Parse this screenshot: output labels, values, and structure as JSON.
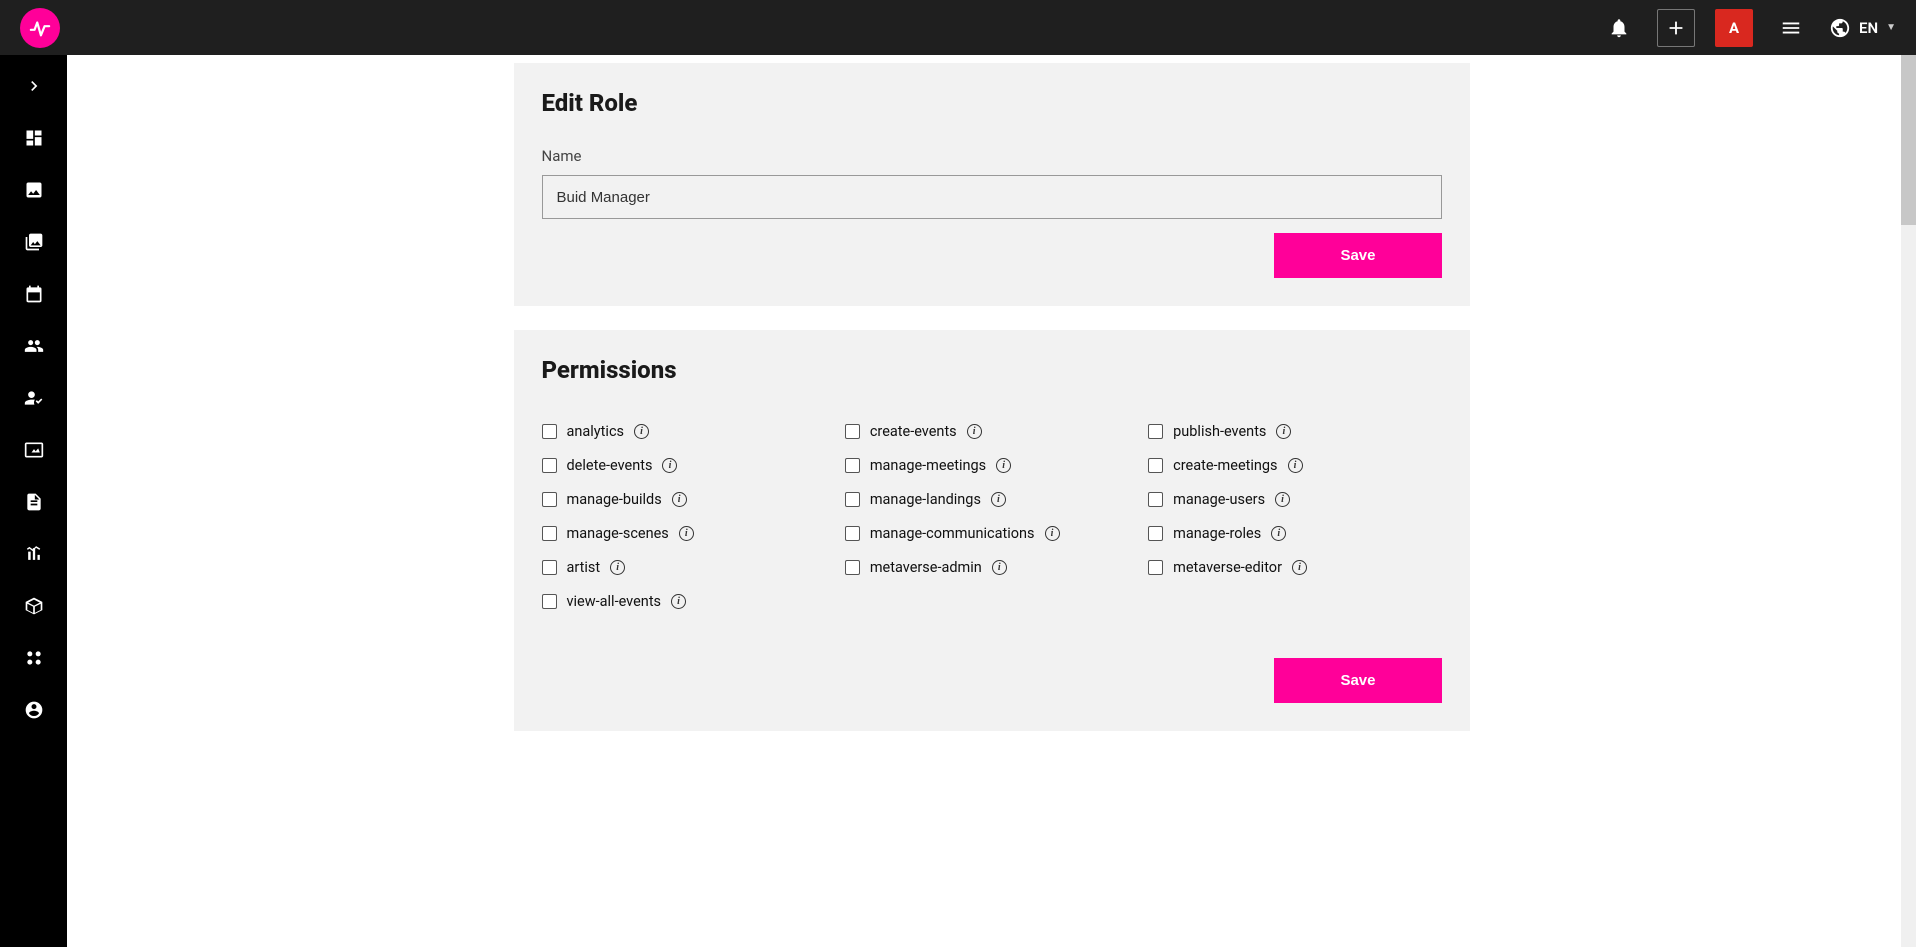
{
  "colors": {
    "accent": "#ff0099",
    "avatar_bg": "#d9281f",
    "topbar_bg": "#1f1f1f",
    "sidebar_bg": "#000000",
    "card_bg": "#f2f2f2"
  },
  "topbar": {
    "avatar_letter": "A",
    "language": "EN"
  },
  "edit_role": {
    "title": "Edit Role",
    "name_label": "Name",
    "name_value": "Buid Manager",
    "save_label": "Save"
  },
  "permissions": {
    "title": "Permissions",
    "save_label": "Save",
    "items": [
      {
        "label": "analytics",
        "checked": false
      },
      {
        "label": "create-events",
        "checked": false
      },
      {
        "label": "publish-events",
        "checked": false
      },
      {
        "label": "delete-events",
        "checked": false
      },
      {
        "label": "manage-meetings",
        "checked": false
      },
      {
        "label": "create-meetings",
        "checked": false
      },
      {
        "label": "manage-builds",
        "checked": false
      },
      {
        "label": "manage-landings",
        "checked": false
      },
      {
        "label": "manage-users",
        "checked": false
      },
      {
        "label": "manage-scenes",
        "checked": false
      },
      {
        "label": "manage-communications",
        "checked": false
      },
      {
        "label": "manage-roles",
        "checked": false
      },
      {
        "label": "artist",
        "checked": false
      },
      {
        "label": "metaverse-admin",
        "checked": false
      },
      {
        "label": "metaverse-editor",
        "checked": false
      },
      {
        "label": "view-all-events",
        "checked": false
      }
    ]
  }
}
